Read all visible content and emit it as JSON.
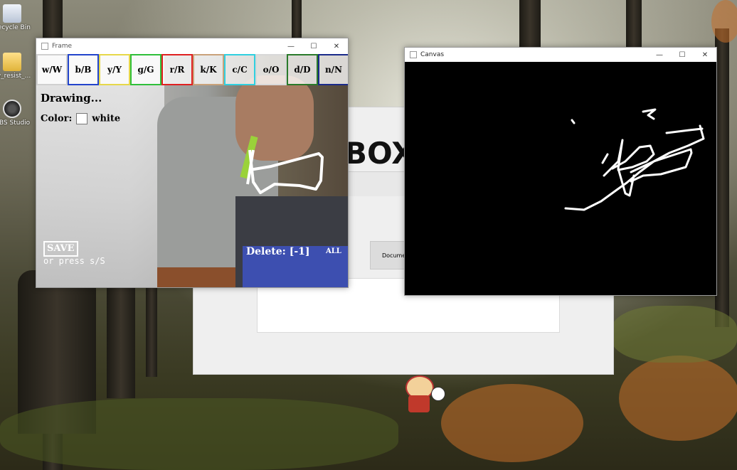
{
  "desktop": {
    "icons": [
      {
        "label": "Recycle Bin",
        "name": "recycle-bin-icon"
      },
      {
        "label": "fw_resist_...",
        "name": "folder-icon"
      },
      {
        "label": "OBS Studio",
        "name": "obs-studio-icon"
      }
    ]
  },
  "frame_window": {
    "title": "Frame",
    "minimize_glyph": "—",
    "maximize_glyph": "☐",
    "close_glyph": "✕",
    "color_buttons": [
      {
        "label": "w/W",
        "border": "#d0d0d0"
      },
      {
        "label": "b/B",
        "border": "#2244cc"
      },
      {
        "label": "y/Y",
        "border": "#e6d84a"
      },
      {
        "label": "g/G",
        "border": "#2fbf3a"
      },
      {
        "label": "r/R",
        "border": "#e02020"
      },
      {
        "label": "k/K",
        "border": "#c9a27a"
      },
      {
        "label": "c/C",
        "border": "#30d0e0"
      },
      {
        "label": "o/O",
        "border": "#d8d8d8"
      },
      {
        "label": "d/D",
        "border": "#2a7a2a"
      },
      {
        "label": "n/N",
        "border": "#1a2a8a"
      }
    ],
    "status": "Drawing...",
    "color_label": "Color:",
    "color_value": "white",
    "save_label": "SAVE",
    "save_hint": "or press s/S",
    "delete_label": "Delete:",
    "delete_last": "[-1]",
    "delete_all": "ALL"
  },
  "canvas_window": {
    "title": "Canvas",
    "minimize_glyph": "—",
    "maximize_glyph": "☐",
    "close_glyph": "✕"
  },
  "background_app": {
    "heading_fragment": "BOX",
    "button_fragment": "Docume"
  }
}
